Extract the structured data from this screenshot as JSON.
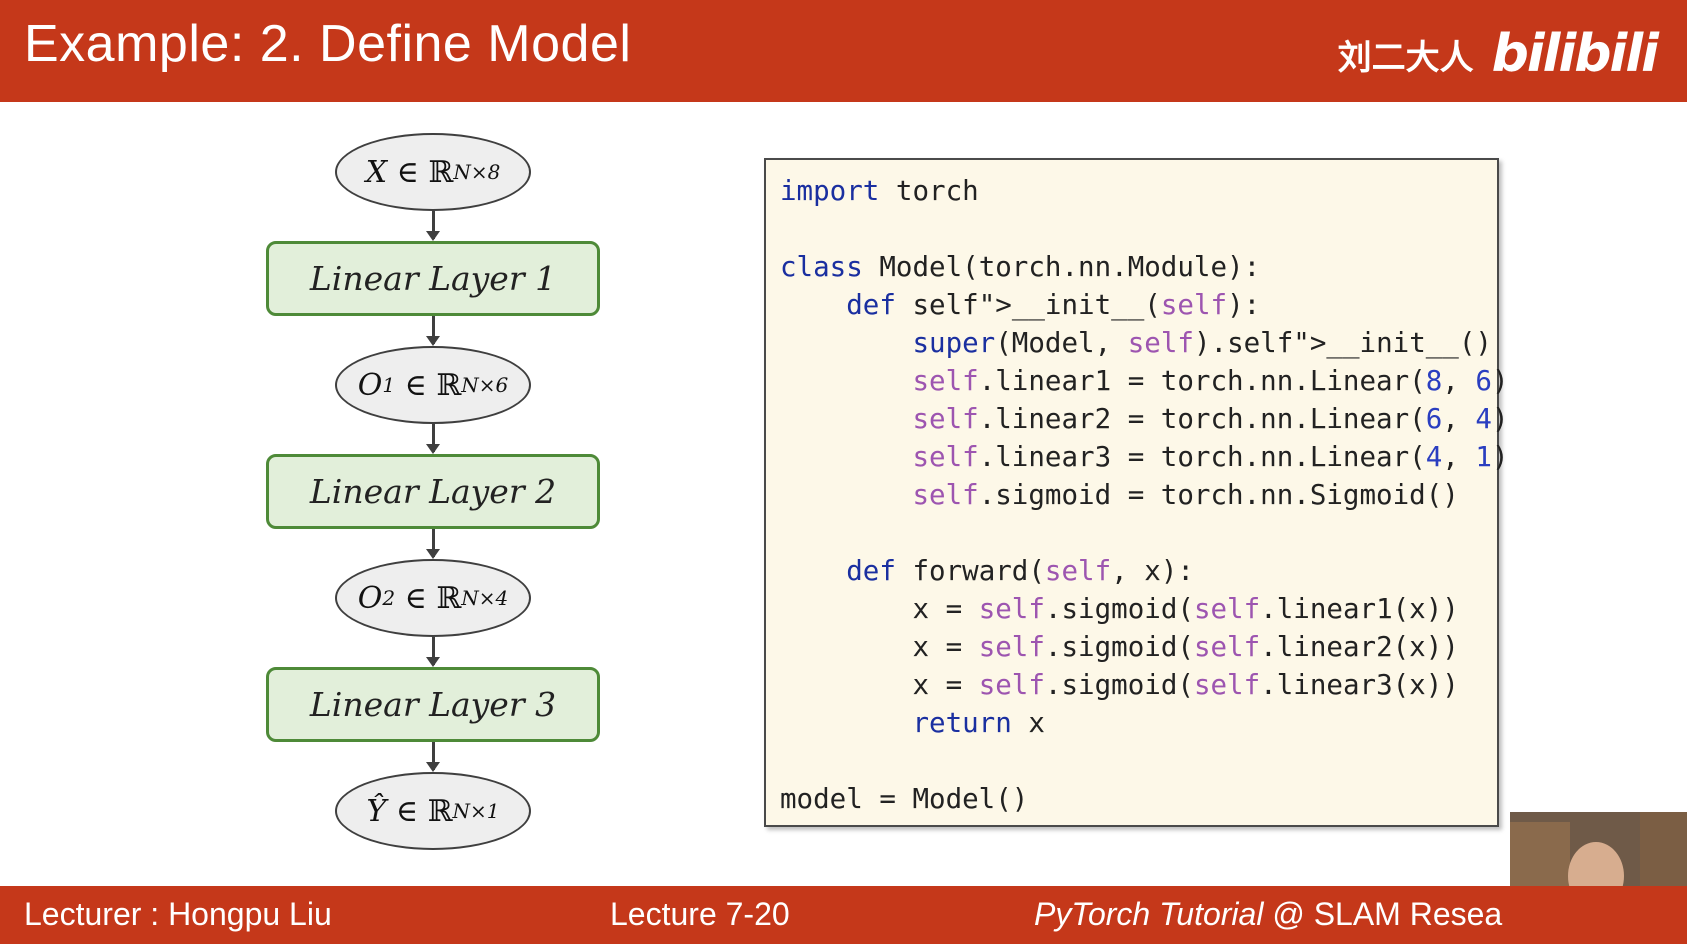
{
  "header": {
    "title": "Example: 2. Define Model",
    "brand_text": "刘二大人",
    "brand_logo": "bilibili"
  },
  "diagram": {
    "input_node": {
      "var": "X",
      "in": "∈",
      "set": "ℝ",
      "dim": "N×8"
    },
    "layer1": "Linear Layer 1",
    "o1_node": {
      "var": "O",
      "sup": "1",
      "in": "∈",
      "set": "ℝ",
      "dim": "N×6"
    },
    "layer2": "Linear Layer 2",
    "o2_node": {
      "var": "O",
      "sup": "2",
      "in": "∈",
      "set": "ℝ",
      "dim": "N×4"
    },
    "layer3": "Linear Layer 3",
    "output_node": {
      "var": "Ŷ",
      "in": "∈",
      "set": "ℝ",
      "dim": "N×1"
    }
  },
  "code": {
    "lines": [
      "import torch",
      "",
      "class Model(torch.nn.Module):",
      "    def __init__(self):",
      "        super(Model, self).__init__()",
      "        self.linear1 = torch.nn.Linear(8, 6)",
      "        self.linear2 = torch.nn.Linear(6, 4)",
      "        self.linear3 = torch.nn.Linear(4, 1)",
      "        self.sigmoid = torch.nn.Sigmoid()",
      "",
      "    def forward(self, x):",
      "        x = self.sigmoid(self.linear1(x))",
      "        x = self.sigmoid(self.linear2(x))",
      "        x = self.sigmoid(self.linear3(x))",
      "        return x",
      "",
      "model = Model()"
    ]
  },
  "footer": {
    "lecturer": "Lecturer : Hongpu Liu",
    "lecture": "Lecture 7-20",
    "course_italic": "PyTorch Tutorial",
    "course_rest": " @ SLAM Resea"
  },
  "colors": {
    "bar": "#c5381a",
    "layer_fill": "#e2efda",
    "layer_border": "#4e8a38",
    "code_bg": "#fdf8e8",
    "keyword": "#1a2fa0",
    "self": "#9d55b0"
  }
}
